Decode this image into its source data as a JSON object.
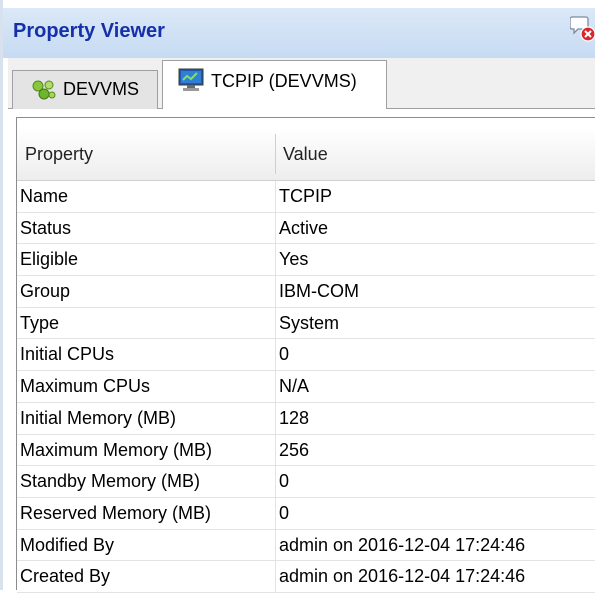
{
  "window": {
    "title": "Property Viewer",
    "title_icon": "comment-close-icon"
  },
  "tabs": [
    {
      "label": "DEVVMS",
      "icon": "cluster-icon",
      "active": false
    },
    {
      "label": "TCPIP (DEVVMS)",
      "icon": "monitor-icon",
      "active": true
    }
  ],
  "table": {
    "headers": {
      "property": "Property",
      "value": "Value"
    },
    "rows": [
      {
        "property": "Name",
        "value": "TCPIP"
      },
      {
        "property": "Status",
        "value": "Active"
      },
      {
        "property": "Eligible",
        "value": "Yes"
      },
      {
        "property": "Group",
        "value": "IBM-COM"
      },
      {
        "property": "Type",
        "value": "System"
      },
      {
        "property": "Initial CPUs",
        "value": "0"
      },
      {
        "property": "Maximum CPUs",
        "value": "N/A"
      },
      {
        "property": "Initial Memory (MB)",
        "value": "128"
      },
      {
        "property": "Maximum Memory (MB)",
        "value": "256"
      },
      {
        "property": "Standby Memory (MB)",
        "value": "0"
      },
      {
        "property": "Reserved Memory (MB)",
        "value": "0"
      },
      {
        "property": "Modified By",
        "value": "admin on 2016-12-04 17:24:46"
      },
      {
        "property": "Created By",
        "value": "admin on 2016-12-04 17:24:46"
      }
    ]
  },
  "colors": {
    "title_text": "#1530a8",
    "title_bg": "#c6dbf3"
  }
}
